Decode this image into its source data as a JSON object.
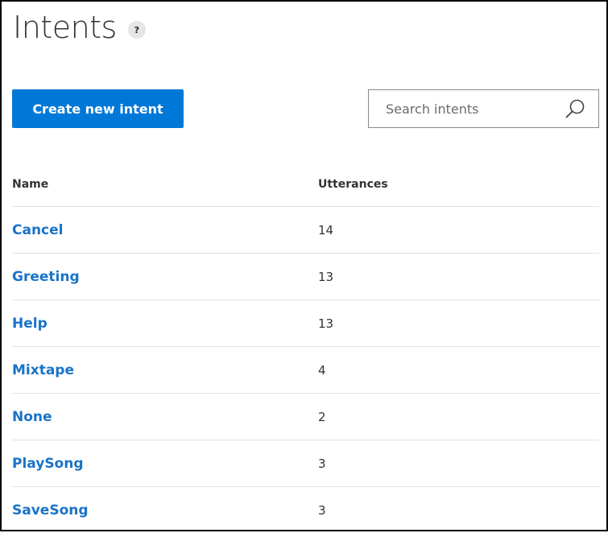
{
  "page": {
    "title": "Intents",
    "help_badge": "?"
  },
  "toolbar": {
    "create_label": "Create new intent"
  },
  "search": {
    "placeholder": "Search intents",
    "value": "",
    "icon": "search-icon"
  },
  "table": {
    "columns": [
      "Name",
      "Utterances"
    ],
    "rows": [
      {
        "name": "Cancel",
        "utterances": "14"
      },
      {
        "name": "Greeting",
        "utterances": "13"
      },
      {
        "name": "Help",
        "utterances": "13"
      },
      {
        "name": "Mixtape",
        "utterances": "4"
      },
      {
        "name": "None",
        "utterances": "2"
      },
      {
        "name": "PlaySong",
        "utterances": "3"
      },
      {
        "name": "SaveSong",
        "utterances": "3"
      }
    ]
  },
  "colors": {
    "accent": "#0078d7",
    "link": "#1a73c7",
    "text": "#333333",
    "divider": "#e1e1e1"
  }
}
